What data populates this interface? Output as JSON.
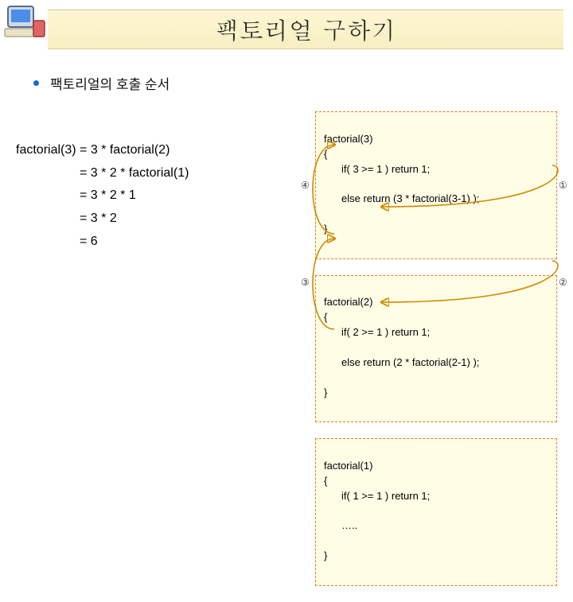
{
  "title": "팩토리얼 구하기",
  "subtitle": "팩토리얼의 호출 순서",
  "expansion": {
    "l1": "factorial(3) = 3 * factorial(2)",
    "l2": "                  = 3 * 2 * factorial(1)",
    "l3": "                  = 3 * 2 * 1",
    "l4": "                  = 3 * 2",
    "l5": "                  = 6"
  },
  "code": {
    "box1": {
      "head": "factorial(3)",
      "open": "{",
      "l1": "if( 3 >= 1 ) return 1;",
      "l2": "else return (3 * factorial(3-1) );",
      "close": "}"
    },
    "box2": {
      "head": "factorial(2)",
      "open": "{",
      "l1": "if( 2 >= 1 ) return 1;",
      "l2": "else return (2 * factorial(2-1) );",
      "close": "}"
    },
    "box3": {
      "head": "factorial(1)",
      "open": "{",
      "l1": "if( 1 >= 1 ) return 1;",
      "l2": "…..",
      "close": "}"
    }
  },
  "markers": {
    "m1": "①",
    "m2": "②",
    "m3": "③",
    "m4": "④"
  }
}
